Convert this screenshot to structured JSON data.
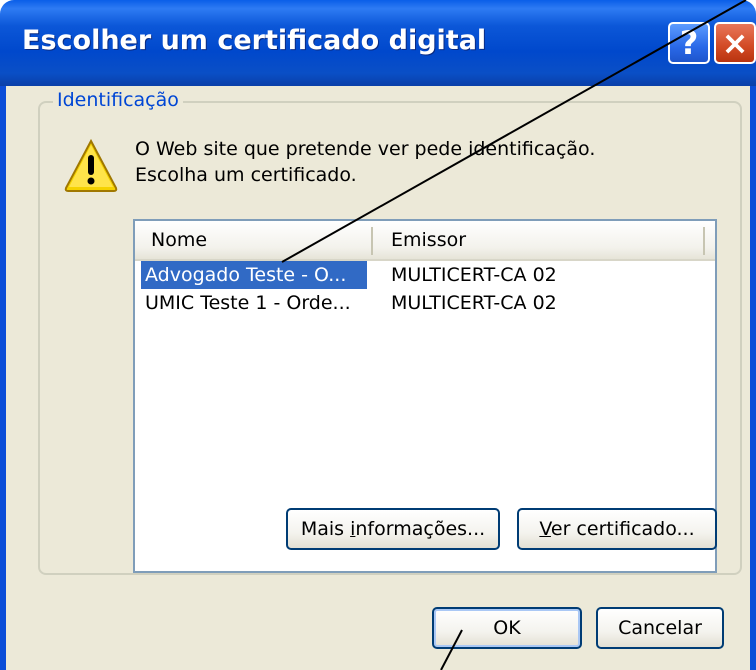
{
  "dialog": {
    "title": "Escolher um certificado digital",
    "help_glyph": "?",
    "close_glyph": "×"
  },
  "group": {
    "legend": "Identificação"
  },
  "message": {
    "line1": "O Web site que pretende ver pede identificação.",
    "line2": "Escolha um certificado."
  },
  "list": {
    "columns": [
      "Nome",
      "Emissor"
    ],
    "rows": [
      {
        "nome": "Advogado Teste - O...",
        "emissor": "MULTICERT-CA 02",
        "selected": true
      },
      {
        "nome": "UMIC Teste 1 - Orde...",
        "emissor": "MULTICERT-CA 02",
        "selected": false
      }
    ]
  },
  "buttons": {
    "more_info": {
      "pre": "Mais ",
      "accel": "i",
      "post": "nformações..."
    },
    "view_cert": {
      "pre": "",
      "accel": "V",
      "post": "er certificado..."
    },
    "ok": "OK",
    "cancel": "Cancelar"
  },
  "colors": {
    "title_blue": "#0048cc",
    "dialog_face": "#ece9d8",
    "selection": "#316ac5",
    "legend_text": "#0046d5"
  },
  "icons": {
    "warning": "warning-icon",
    "help": "help-icon",
    "close": "close-icon"
  }
}
